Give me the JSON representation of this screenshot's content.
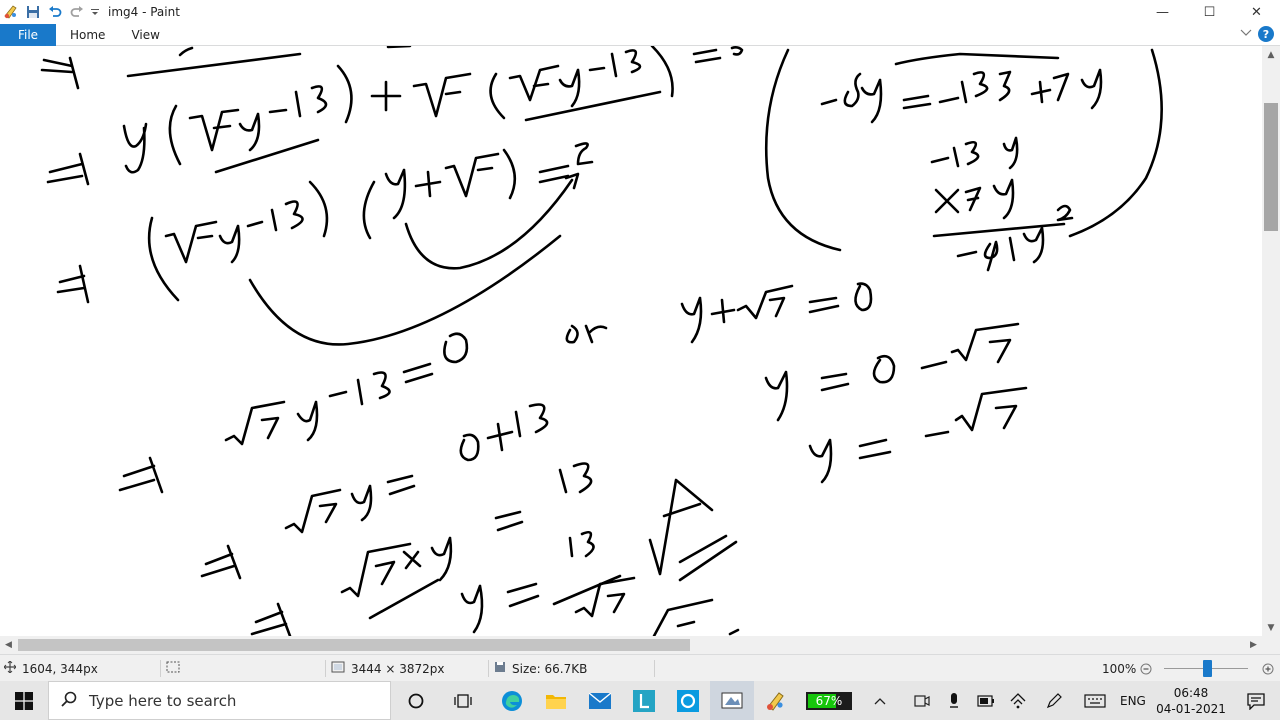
{
  "window": {
    "title": "img4 - Paint",
    "controls": {
      "minimize": "—",
      "maximize": "☐",
      "close": "✕"
    }
  },
  "ribbon": {
    "tabs": [
      {
        "label": "File"
      },
      {
        "label": "Home"
      },
      {
        "label": "View"
      }
    ],
    "help_label": "?"
  },
  "statusbar": {
    "cursor_position": "1604, 344px",
    "image_size": "3444 × 3872px",
    "file_size": "Size: 66.7KB",
    "zoom": "100%"
  },
  "taskbar": {
    "search_placeholder": "Type here to search",
    "battery": "67%",
    "battery_level": 0.67,
    "language": "ENG",
    "time": "06:48",
    "date": "04-01-2021"
  },
  "colors": {
    "accent": "#1979ca",
    "ink": "#000000",
    "battery_fill": "#16c60c"
  }
}
